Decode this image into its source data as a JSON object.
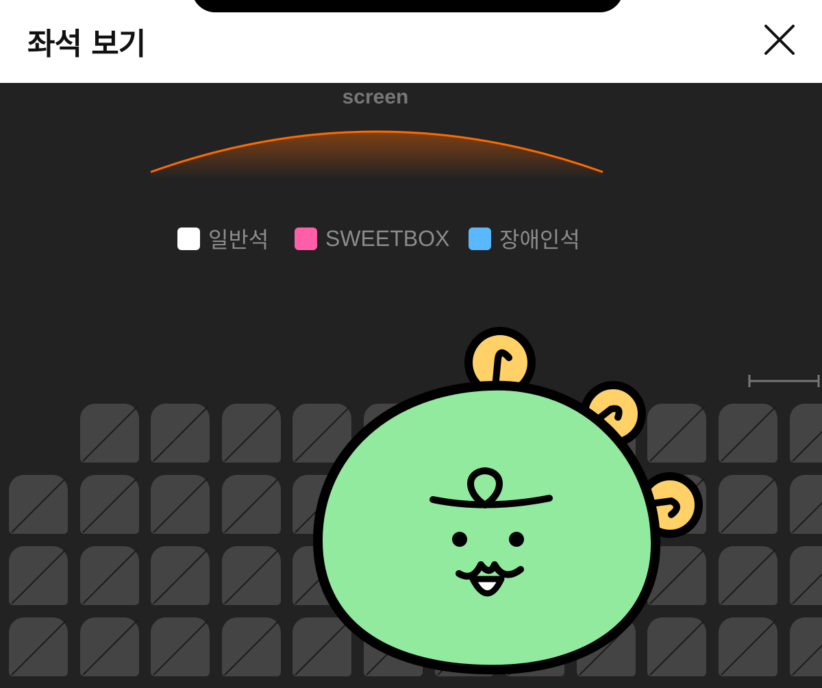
{
  "header": {
    "title": "좌석 보기",
    "close_icon": "close-icon"
  },
  "seatmap": {
    "screen_label": "screen",
    "legend": [
      {
        "label": "일반석",
        "color": "#ffffff"
      },
      {
        "label": "SWEETBOX",
        "color": "#ff5fa8"
      },
      {
        "label": "장애인석",
        "color": "#5ab8ff"
      }
    ],
    "seat_state": "unavailable",
    "seat_rows": [
      {
        "row": 1,
        "seats": 11
      },
      {
        "row": 2,
        "seats": 12
      },
      {
        "row": 3,
        "seats": 12
      },
      {
        "row": 4,
        "seats": 12
      }
    ],
    "colors": {
      "background": "#222222",
      "seat": "#444444",
      "screen_glow": "#ff6a00"
    }
  },
  "overlay": {
    "icon": "green-dinosaur-sticker-icon",
    "color": "#92ea9f"
  }
}
